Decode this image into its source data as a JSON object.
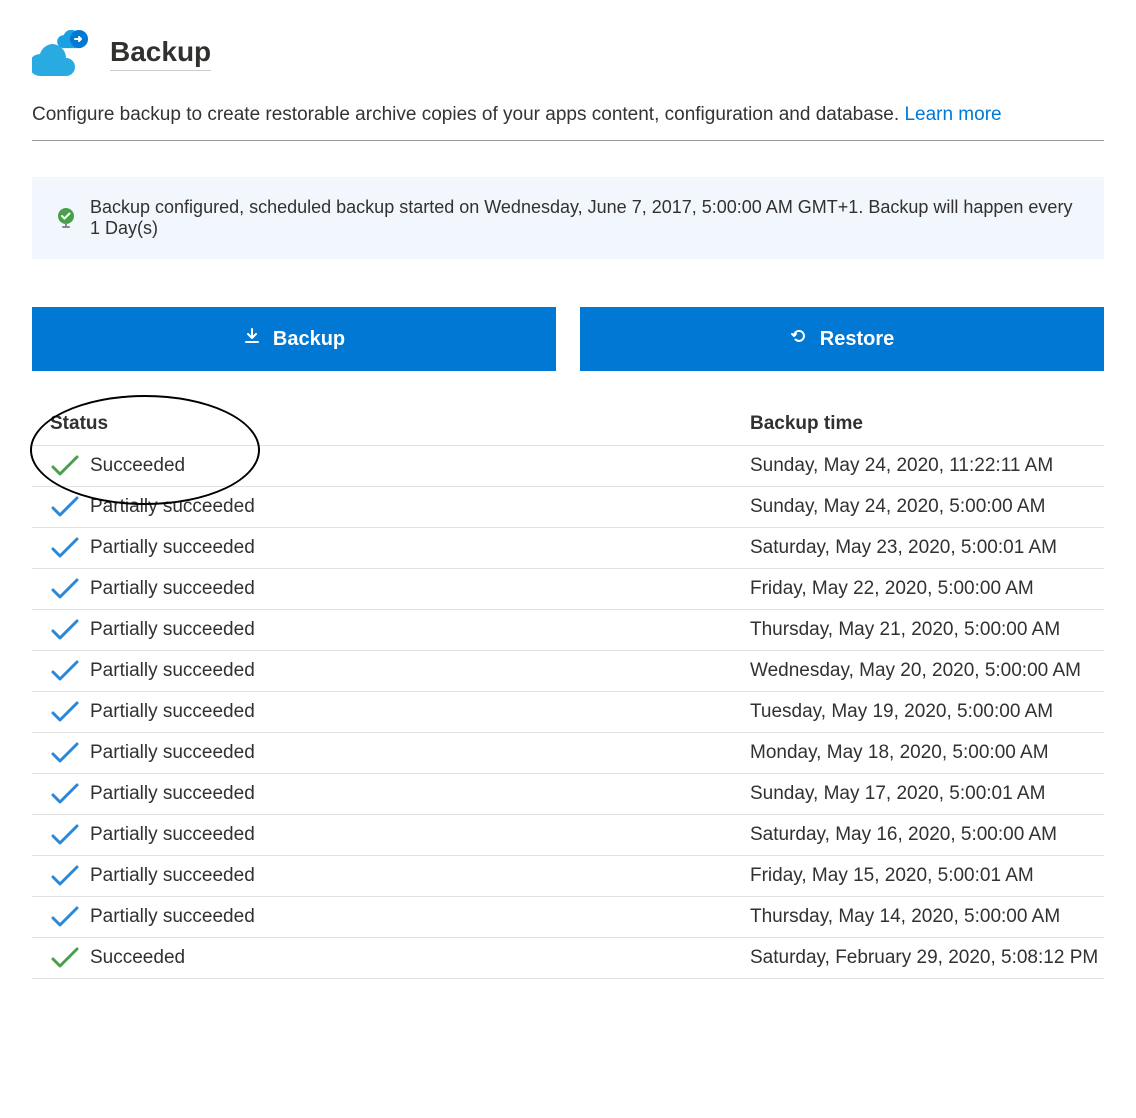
{
  "header": {
    "title": "Backup"
  },
  "description": {
    "text": "Configure backup to create restorable archive copies of your apps content, configuration and database. ",
    "link_label": "Learn more"
  },
  "info_banner": {
    "text": "Backup configured, scheduled backup started on Wednesday, June 7, 2017, 5:00:00 AM GMT+1. Backup will happen every 1 Day(s)"
  },
  "buttons": {
    "backup": "Backup",
    "restore": "Restore"
  },
  "table": {
    "headers": {
      "status": "Status",
      "time": "Backup time"
    },
    "status_labels": {
      "succeeded": "Succeeded",
      "partial": "Partially succeeded"
    },
    "rows": [
      {
        "status": "succeeded",
        "time": "Sunday, May 24, 2020, 11:22:11 AM"
      },
      {
        "status": "partial",
        "time": "Sunday, May 24, 2020, 5:00:00 AM"
      },
      {
        "status": "partial",
        "time": "Saturday, May 23, 2020, 5:00:01 AM"
      },
      {
        "status": "partial",
        "time": "Friday, May 22, 2020, 5:00:00 AM"
      },
      {
        "status": "partial",
        "time": "Thursday, May 21, 2020, 5:00:00 AM"
      },
      {
        "status": "partial",
        "time": "Wednesday, May 20, 2020, 5:00:00 AM"
      },
      {
        "status": "partial",
        "time": "Tuesday, May 19, 2020, 5:00:00 AM"
      },
      {
        "status": "partial",
        "time": "Monday, May 18, 2020, 5:00:00 AM"
      },
      {
        "status": "partial",
        "time": "Sunday, May 17, 2020, 5:00:01 AM"
      },
      {
        "status": "partial",
        "time": "Saturday, May 16, 2020, 5:00:00 AM"
      },
      {
        "status": "partial",
        "time": "Friday, May 15, 2020, 5:00:01 AM"
      },
      {
        "status": "partial",
        "time": "Thursday, May 14, 2020, 5:00:00 AM"
      },
      {
        "status": "succeeded",
        "time": "Saturday, February 29, 2020, 5:08:12 PM"
      }
    ]
  },
  "colors": {
    "succeeded": "#4aa04a",
    "partial": "#2b88d8"
  }
}
